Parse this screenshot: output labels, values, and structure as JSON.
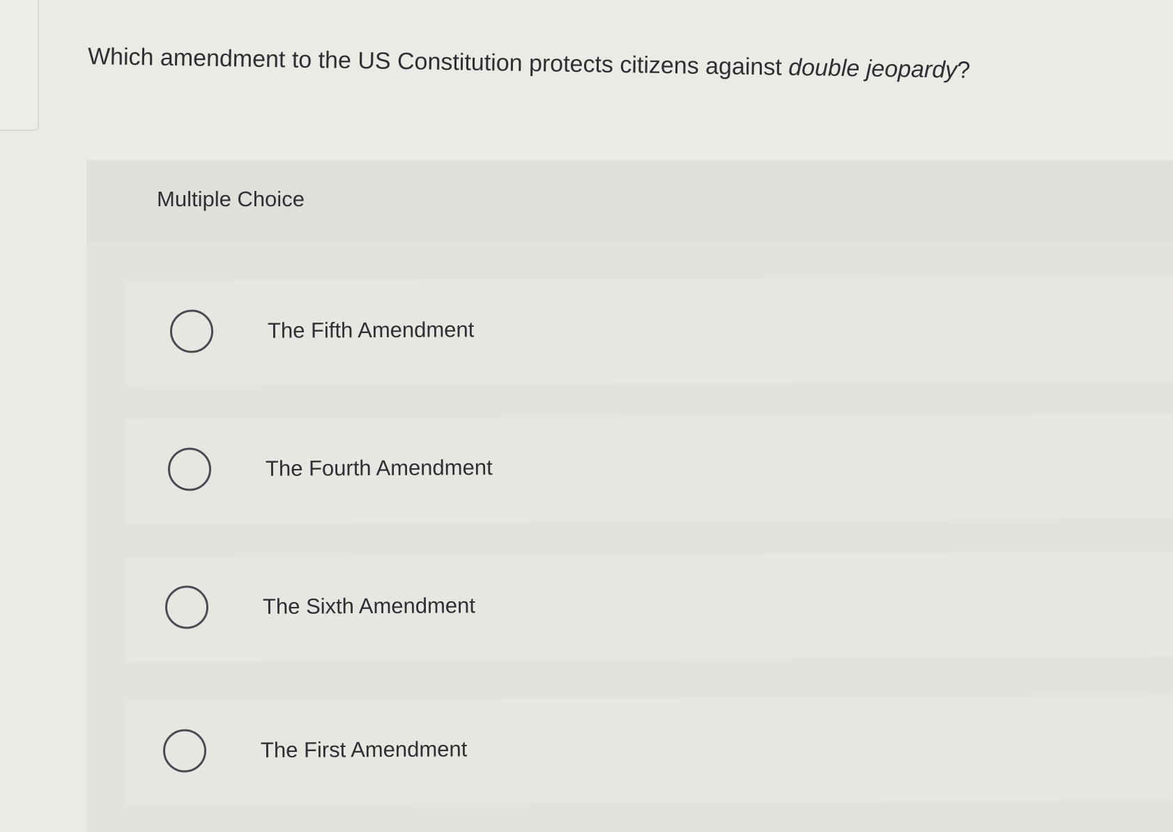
{
  "question": {
    "prefix": "Which amendment to the US Constitution protects citizens against ",
    "emphasis": "double jeopardy",
    "suffix": "?"
  },
  "choice_block": {
    "type_label": "Multiple Choice",
    "options": [
      {
        "label": "The Fifth Amendment",
        "selected": false
      },
      {
        "label": "The Fourth Amendment",
        "selected": false
      },
      {
        "label": "The Sixth Amendment",
        "selected": false
      },
      {
        "label": "The First Amendment",
        "selected": false
      }
    ]
  }
}
